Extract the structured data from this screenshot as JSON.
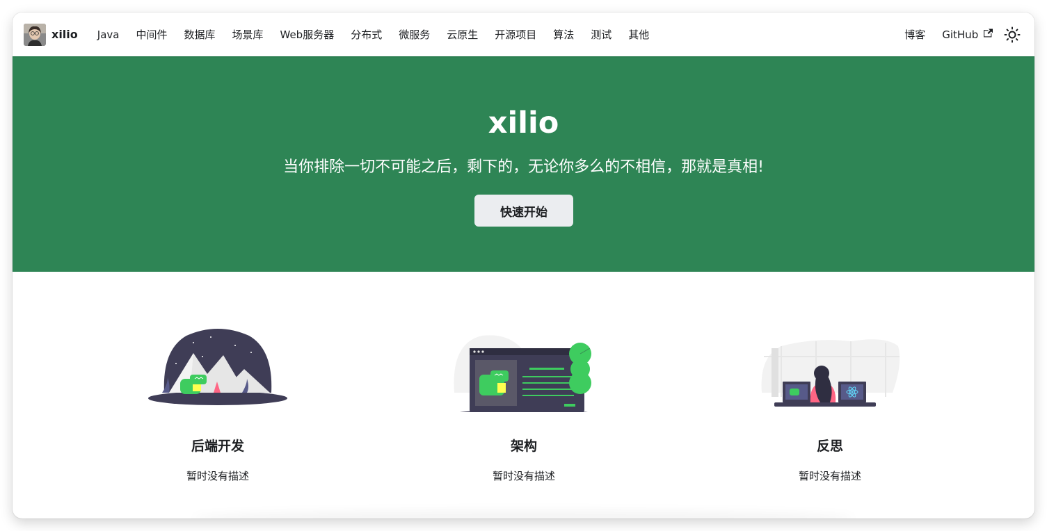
{
  "navbar": {
    "brand_title": "xilio",
    "links": [
      "Java",
      "中间件",
      "数据库",
      "场景库",
      "Web服务器",
      "分布式",
      "微服务",
      "云原生",
      "开源项目",
      "算法",
      "测试",
      "其他"
    ],
    "blog_label": "博客",
    "github_label": "GitHub",
    "theme_icon": "sun-icon"
  },
  "hero": {
    "title": "xilio",
    "subtitle": "当你排除一切不可能之后，剩下的，无论你多么的不相信，那就是真相!",
    "button_label": "快速开始",
    "background_color": "#2e8555"
  },
  "features": [
    {
      "title": "后端开发",
      "description": "暂时没有描述",
      "illustration": "mountain-dino-illustration"
    },
    {
      "title": "架构",
      "description": "暂时没有描述",
      "illustration": "browser-dino-tree-illustration"
    },
    {
      "title": "反思",
      "description": "暂时没有描述",
      "illustration": "developer-monitors-illustration"
    }
  ],
  "colors": {
    "primary": "#2e8555",
    "dino_green": "#3ecc5f",
    "dark_purple": "#3f3d56",
    "button_bg": "#ebedf0"
  }
}
